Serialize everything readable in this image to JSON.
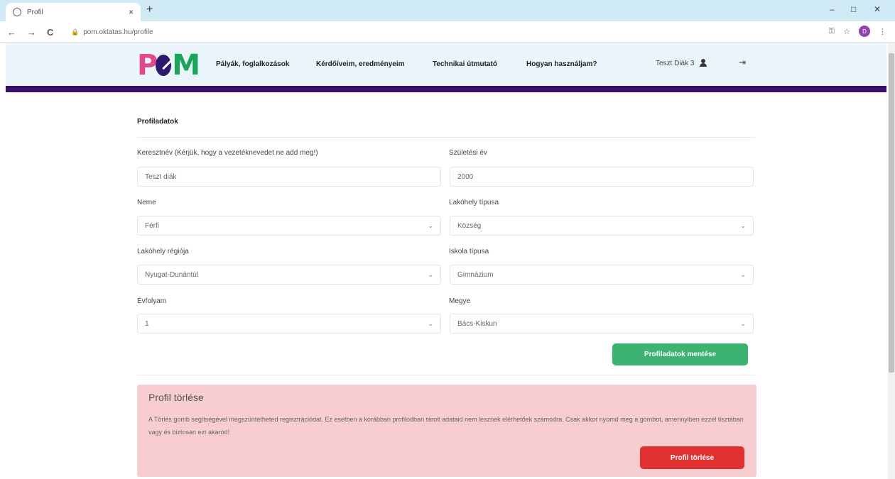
{
  "browser": {
    "tab_title": "Profil",
    "tab_close": "×",
    "new_tab": "+",
    "url": "pom.oktatas.hu/profile",
    "win_min": "–",
    "win_max": "□",
    "win_close": "✕",
    "back": "←",
    "forward": "→",
    "reload": "C",
    "avatar_letter": "D"
  },
  "site": {
    "nav": [
      "Pályák, foglalkozások",
      "Kérdőíveim, eredményeim",
      "Technikai útmutató",
      "Hogyan használjam?"
    ],
    "user_name": "Teszt Diák 3"
  },
  "form": {
    "section_title": "Profiladatok",
    "first_name_label": "Keresztnév (Kérjük, hogy a vezetéknevedet ne add meg!)",
    "first_name_value": "Teszt diák",
    "birth_year_label": "Születési év",
    "birth_year_value": "2000",
    "gender_label": "Neme",
    "gender_value": "Férfi",
    "residence_type_label": "Lakóhely típusa",
    "residence_type_value": "Község",
    "region_label": "Lakóhely régiója",
    "region_value": "Nyugat-Dunántúl",
    "school_type_label": "Iskola típusa",
    "school_type_value": "Gimnázium",
    "grade_label": "Évfolyam",
    "grade_value": "1",
    "county_label": "Megye",
    "county_value": "Bács-Kiskun",
    "save_button": "Profiladatok mentése"
  },
  "delete": {
    "title": "Profil törlése",
    "text": "A Törlés gomb segítségével megszüntetheted regisztrációdat. Ez esetben a korábban profilodban tárolt adataid nem lesznek elérhetőek számodra. Csak akkor nyomd meg a gombot, amennyiben ezzel tisztában vagy és biztosan ezt akarod!",
    "button": "Profil törlése"
  },
  "colors": {
    "header_bg": "#eaf4fb",
    "header_bar": "#3a0f6e",
    "save_green": "#3cb371",
    "delete_red": "#e03131",
    "delete_panel": "#f8cdd0"
  }
}
